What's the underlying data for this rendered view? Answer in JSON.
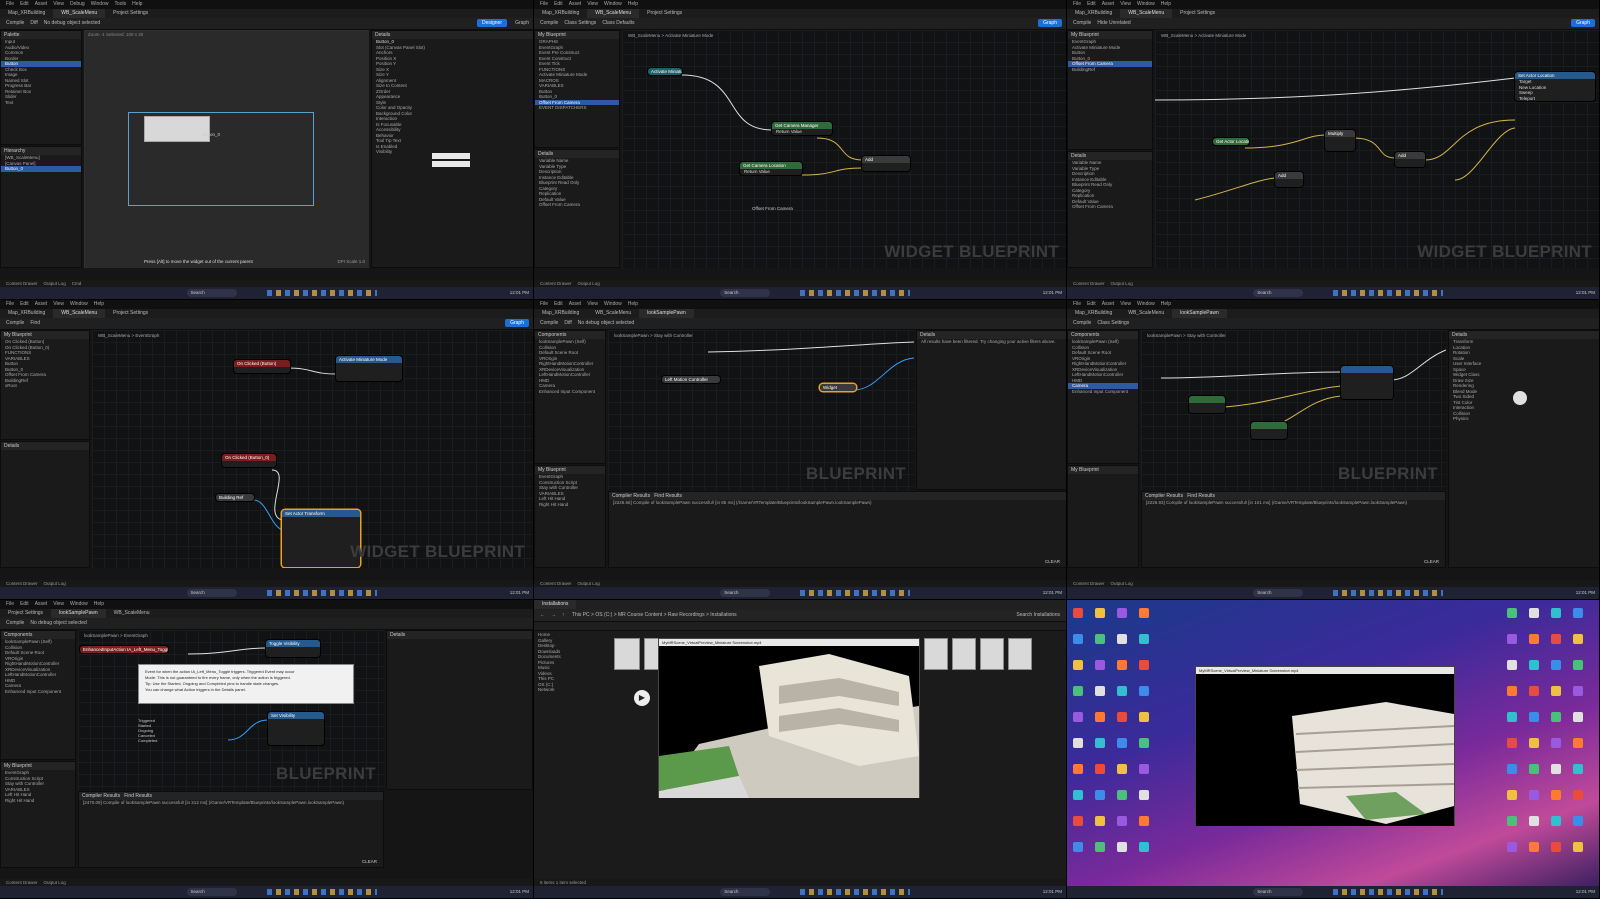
{
  "common": {
    "menu": [
      "File",
      "Edit",
      "Asset",
      "View",
      "Debug",
      "Window",
      "Tools",
      "Help"
    ],
    "map_tab": "Map_XRBuilding",
    "widget_tab": "WB_ScaleMenu",
    "project_settings_tab": "Project Settings",
    "pawn_tab": "lookSamplePawn",
    "parent_class": "Parent class: User Widget",
    "toolbar": [
      "Compile",
      "Diff",
      "Find",
      "Hide Unrelated",
      "Class Settings",
      "Class Defaults",
      "No debug object selected"
    ],
    "designer_btn": "Designer",
    "graph_btn": "Graph",
    "statusbar": [
      "Content Drawer",
      "Output Log",
      "Cmd"
    ],
    "taskbar_search": "Search",
    "taskbar_time": "12:01 PM",
    "widget_watermark": "WIDGET BLUEPRINT",
    "bp_watermark": "BLUEPRINT"
  },
  "t1": {
    "palette_title": "Palette",
    "library_title": "Library",
    "hierarchy_title": "Hierarchy",
    "palette_items": [
      "Input",
      "Audio/Video",
      "Common",
      "Border",
      "Button",
      "Check Box",
      "Image",
      "Named Slot",
      "Progress Bar",
      "Retainer Box",
      "Slider",
      "Text"
    ],
    "hierarchy_items": [
      "[WB_ScaleMenu]",
      "[Canvas Panel]",
      "Button_0"
    ],
    "viewport_info": "Zoom -1  Selected: 100 x 30",
    "hint": "Press [Alt] to move the widget out of the current parent",
    "dpi": "DPI Scale 1.0",
    "button_label": "Button_0",
    "details_title": "Details",
    "details_name": "Button_0",
    "details_rows": [
      "Slot (Canvas Panel Slot)",
      "Anchors",
      "Position X",
      "Position Y",
      "Size X",
      "Size Y",
      "Alignment",
      "Size to Content",
      "ZOrder",
      "Appearance",
      "Style",
      "Color and Opacity",
      "Background Color",
      "Interaction",
      "Is Focusable",
      "Accessibility",
      "Behavior",
      "Tool Tip Text",
      "Is Enabled",
      "Visibility"
    ]
  },
  "t2": {
    "mybp_title": "My Blueprint",
    "breadcrumb": "WB_ScaleMenu  >  Activate Miniature Mode",
    "mybp_rows": [
      "GRAPHS",
      "EventGraph",
      "Event Pre Construct",
      "Event Construct",
      "Event Tick",
      "FUNCTIONS",
      "Activate Miniature Mode",
      "MACROS",
      "VARIABLES",
      "Button",
      "Button_0",
      "Offset From Camera",
      "EVENT DISPATCHERS"
    ],
    "details_title": "Details",
    "details_rows": [
      "Variable Name",
      "Variable Type",
      "Description",
      "Instance Editable",
      "Blueprint Read Only",
      "Category",
      "Replication",
      "Default Value",
      "Offset From Camera"
    ],
    "node_get_camera": "Get Camera Manager",
    "node_return": "Return Value",
    "node_get_location": "Get Camera Location",
    "node_offset": "Offset From Camera",
    "node_add": "Add",
    "node_entry": "Activate Miniature Mode"
  },
  "t3": {
    "breadcrumb": "WB_ScaleMenu  >  Activate Miniature Mode",
    "node_set_transform": "Set Actor Location",
    "node_add": "Add",
    "node_multiply": "Multiply",
    "node_get_actor": "Get Actor Location",
    "pin_rows": [
      "Target",
      "New Location",
      "Sweep",
      "Teleport"
    ],
    "mybp_rows": [
      "EventGraph",
      "Activate Miniature Mode",
      "Button",
      "Button_0",
      "Offset From Camera",
      "BuildingRef"
    ]
  },
  "t4": {
    "breadcrumb": "WB_ScaleMenu  >  EventGraph",
    "node1": "On Clicked (Button)",
    "node2": "Activate Miniature Mode",
    "node3": "On Clicked (Button_0)",
    "node4": "Set Actor Transform",
    "node5": "Building Ref",
    "mybp_rows": [
      "On Clicked (Button)",
      "On Clicked (Button_0)",
      "FUNCTIONS",
      "VARIABLES",
      "Button",
      "Button_0",
      "Offset From Camera",
      "BuildingRef",
      "xRoot"
    ]
  },
  "t5": {
    "components_title": "Components",
    "components": [
      "lookSamplePawn (Self)",
      "Collision",
      "Default Scene Root",
      "VROrigin",
      "RightHandMotionController",
      "XRDeviceVisualization",
      "LeftHandMotionController",
      "HMD",
      "Camera",
      "Enhanced Input Component"
    ],
    "breadcrumb": "lookSamplePawn  >  Stay with Controller",
    "node_left": "Left Motion Controller",
    "node_widget": "Widget",
    "details_title": "Details",
    "details_msg": "All results have been filtered. Try changing your active filters above.",
    "compiler_tab": "Compiler Results",
    "find_tab": "Find Results",
    "log": "[2226.56] Compile of lookSamplePawn successful! [in 85 ms] (/Game/VRTemplate/Blueprints/lookSamplePawn.lookSamplePawn)",
    "clear": "CLEAR",
    "mybp_rows": [
      "EventGraph",
      "Construction Script",
      "Stay with Controller",
      "VARIABLES",
      "Left Hit Hand",
      "Right Hit Hand"
    ]
  },
  "t6": {
    "breadcrumb": "lookSamplePawn  >  Stay with Controller",
    "log": "[2226.93] Compile of lookSamplePawn successful! [in 101 ms] (/Game/VRTemplate/Blueprints/lookSamplePawn.lookSamplePawn)",
    "clear": "CLEAR",
    "details_rows": [
      "Transform",
      "Location",
      "Rotation",
      "Scale",
      "User Interface",
      "Space",
      "Widget Class",
      "Draw Size",
      "Rendering",
      "Blend Mode",
      "Two Sided",
      "Tint Color",
      "Interaction",
      "Collision",
      "Physics"
    ]
  },
  "t7": {
    "breadcrumb": "lookSamplePawn  >  EventGraph",
    "node_header": "EnhancedInputAction IA_Left_Menu_Toggle",
    "popup_lines": [
      "Event for when the action IA_Left_Menu_Toggle triggers. Triggered Event may occur",
      "Mode: This is not guaranteed to fire every frame, only when the action is triggered.",
      "Tip: Use the Started, Ongoing and Completed pins to handle state changes.",
      "You can change what Action triggers in the Details panel."
    ],
    "node_set_vis": "Set Visibility",
    "node_toggle": "Toggle Visibility",
    "pins": [
      "Triggered",
      "Started",
      "Ongoing",
      "Canceled",
      "Completed"
    ],
    "log": "[2470.09] Compile of lookSamplePawn successful! [in 212 ms] (/Game/VRTemplate/Blueprints/lookSamplePawn.lookSamplePawn)",
    "clear": "CLEAR"
  },
  "t8": {
    "explorer_title": "Installations",
    "address": "This PC  >  OS (C:)  >  MR Course Content  >  Raw Recordings  >  Installations",
    "search": "Search Installations",
    "nav_items": [
      "Home",
      "Gallery",
      "Desktop",
      "Downloads",
      "Documents",
      "Pictures",
      "Music",
      "Videos",
      "This PC",
      "OS (C:)",
      "Network"
    ],
    "player_title": "MyMRScene_VirtualPreview_Miniature Screenshot.mp4",
    "status": "8 items   1 item selected"
  },
  "t9": {
    "player_title": "MyMRScene_VirtualPreview_Miniature Screenshot.mp4"
  }
}
